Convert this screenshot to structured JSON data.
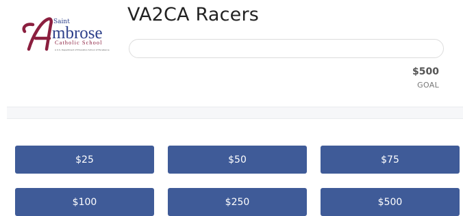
{
  "logo": {
    "saint": "Saint",
    "ambrose": "mbrose",
    "school": "Catholic School",
    "tagline": "A U.S. Department of Education School of Excellence",
    "accent": "#8b1f3f",
    "blue": "#2c3f8a"
  },
  "campaign": {
    "title": "VA2CA Racers",
    "progress_fraction": 0.0,
    "goal_amount": "$500",
    "goal_label": "GOAL"
  },
  "donation_amounts": [
    "$25",
    "$50",
    "$75",
    "$100",
    "$250",
    "$500"
  ],
  "colors": {
    "button_bg": "#3f5b98",
    "button_text": "#ffffff"
  }
}
